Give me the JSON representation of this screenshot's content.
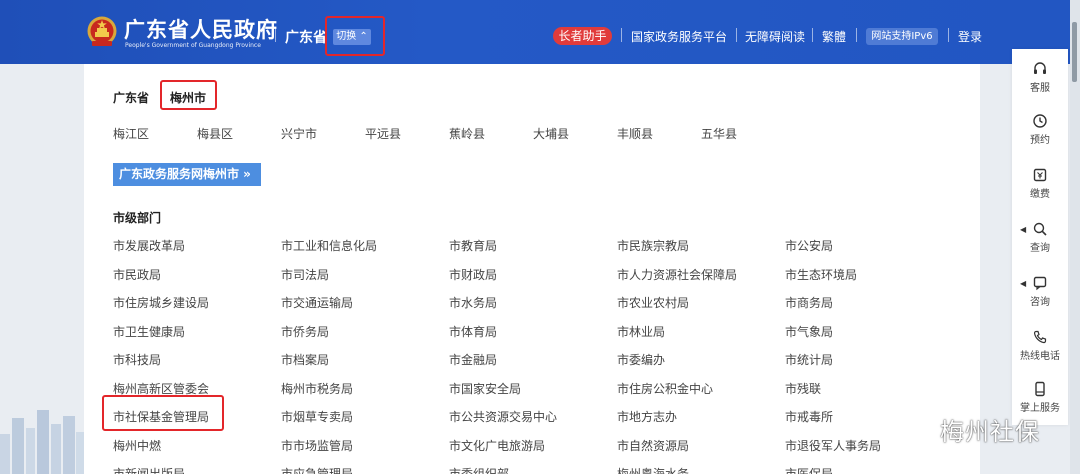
{
  "header": {
    "site_name": "广东省人民政府",
    "site_name_en": "People's Government of Guangdong Province",
    "province": "广东省",
    "switch_label": "切换",
    "elder_label": "长者助手",
    "links": [
      "国家政务服务平台",
      "无障碍阅读",
      "繁體",
      "网站支持IPv6",
      "登录"
    ]
  },
  "region": {
    "province": "广东省",
    "city": "梅州市",
    "districts": [
      "梅江区",
      "梅县区",
      "兴宁市",
      "平远县",
      "蕉岭县",
      "大埔县",
      "丰顺县",
      "五华县"
    ]
  },
  "banner": {
    "label": "广东政务服务网梅州市 »"
  },
  "departments": {
    "title": "市级部门",
    "rows": [
      [
        "市发展改革局",
        "市工业和信息化局",
        "市教育局",
        "市民族宗教局",
        "市公安局"
      ],
      [
        "市民政局",
        "市司法局",
        "市财政局",
        "市人力资源社会保障局",
        "市生态环境局"
      ],
      [
        "市住房城乡建设局",
        "市交通运输局",
        "市水务局",
        "市农业农村局",
        "市商务局"
      ],
      [
        "市卫生健康局",
        "市侨务局",
        "市体育局",
        "市林业局",
        "市气象局"
      ],
      [
        "市科技局",
        "市档案局",
        "市金融局",
        "市委编办",
        "市统计局"
      ],
      [
        "梅州高新区管委会",
        "梅州市税务局",
        "市国家安全局",
        "市住房公积金中心",
        "市残联"
      ],
      [
        "市社保基金管理局",
        "市烟草专卖局",
        "市公共资源交易中心",
        "市地方志办",
        "市戒毒所"
      ],
      [
        "梅州中燃",
        "市市场监管局",
        "市文化广电旅游局",
        "市自然资源局",
        "市退役军人事务局"
      ],
      [
        "市新闻出版局",
        "市应急管理局",
        "市委组织部",
        "梅州粤海水务",
        "市医保局"
      ]
    ]
  },
  "sidebar": {
    "items": [
      {
        "label": "客服",
        "icon": "headset-icon"
      },
      {
        "label": "预约",
        "icon": "clock-icon"
      },
      {
        "label": "缴费",
        "icon": "payment-icon"
      },
      {
        "label": "查询",
        "icon": "search-icon"
      },
      {
        "label": "咨询",
        "icon": "chat-icon"
      },
      {
        "label": "热线电话",
        "icon": "phone-icon"
      },
      {
        "label": "掌上服务",
        "icon": "mobile-icon"
      }
    ]
  },
  "watermark": {
    "text": "梅州社保"
  },
  "colors": {
    "header_blue": "#2256c2",
    "elder_red": "#e13b3b",
    "banner_blue": "#4d8ee0",
    "highlight_red": "#e3262a"
  }
}
